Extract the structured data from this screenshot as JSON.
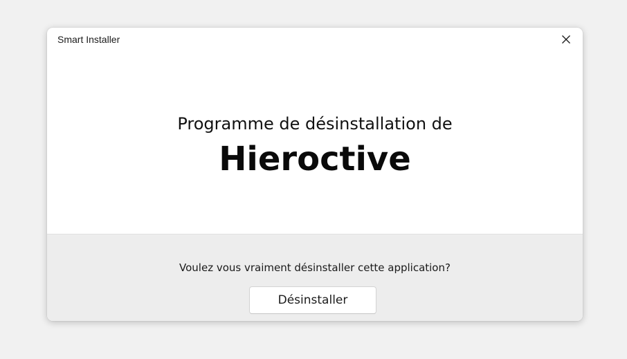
{
  "window": {
    "title": "Smart Installer",
    "close_icon": "close-icon"
  },
  "hero": {
    "subtitle": "Programme de désinstallation de",
    "app_name": "Hieroctive"
  },
  "footer": {
    "question": "Voulez vous vraiment désinstaller cette application?",
    "uninstall_label": "Désinstaller"
  },
  "colors": {
    "background": "#f1f1f1",
    "dialog": "#ffffff",
    "footer": "#ededed",
    "text": "#111111"
  }
}
